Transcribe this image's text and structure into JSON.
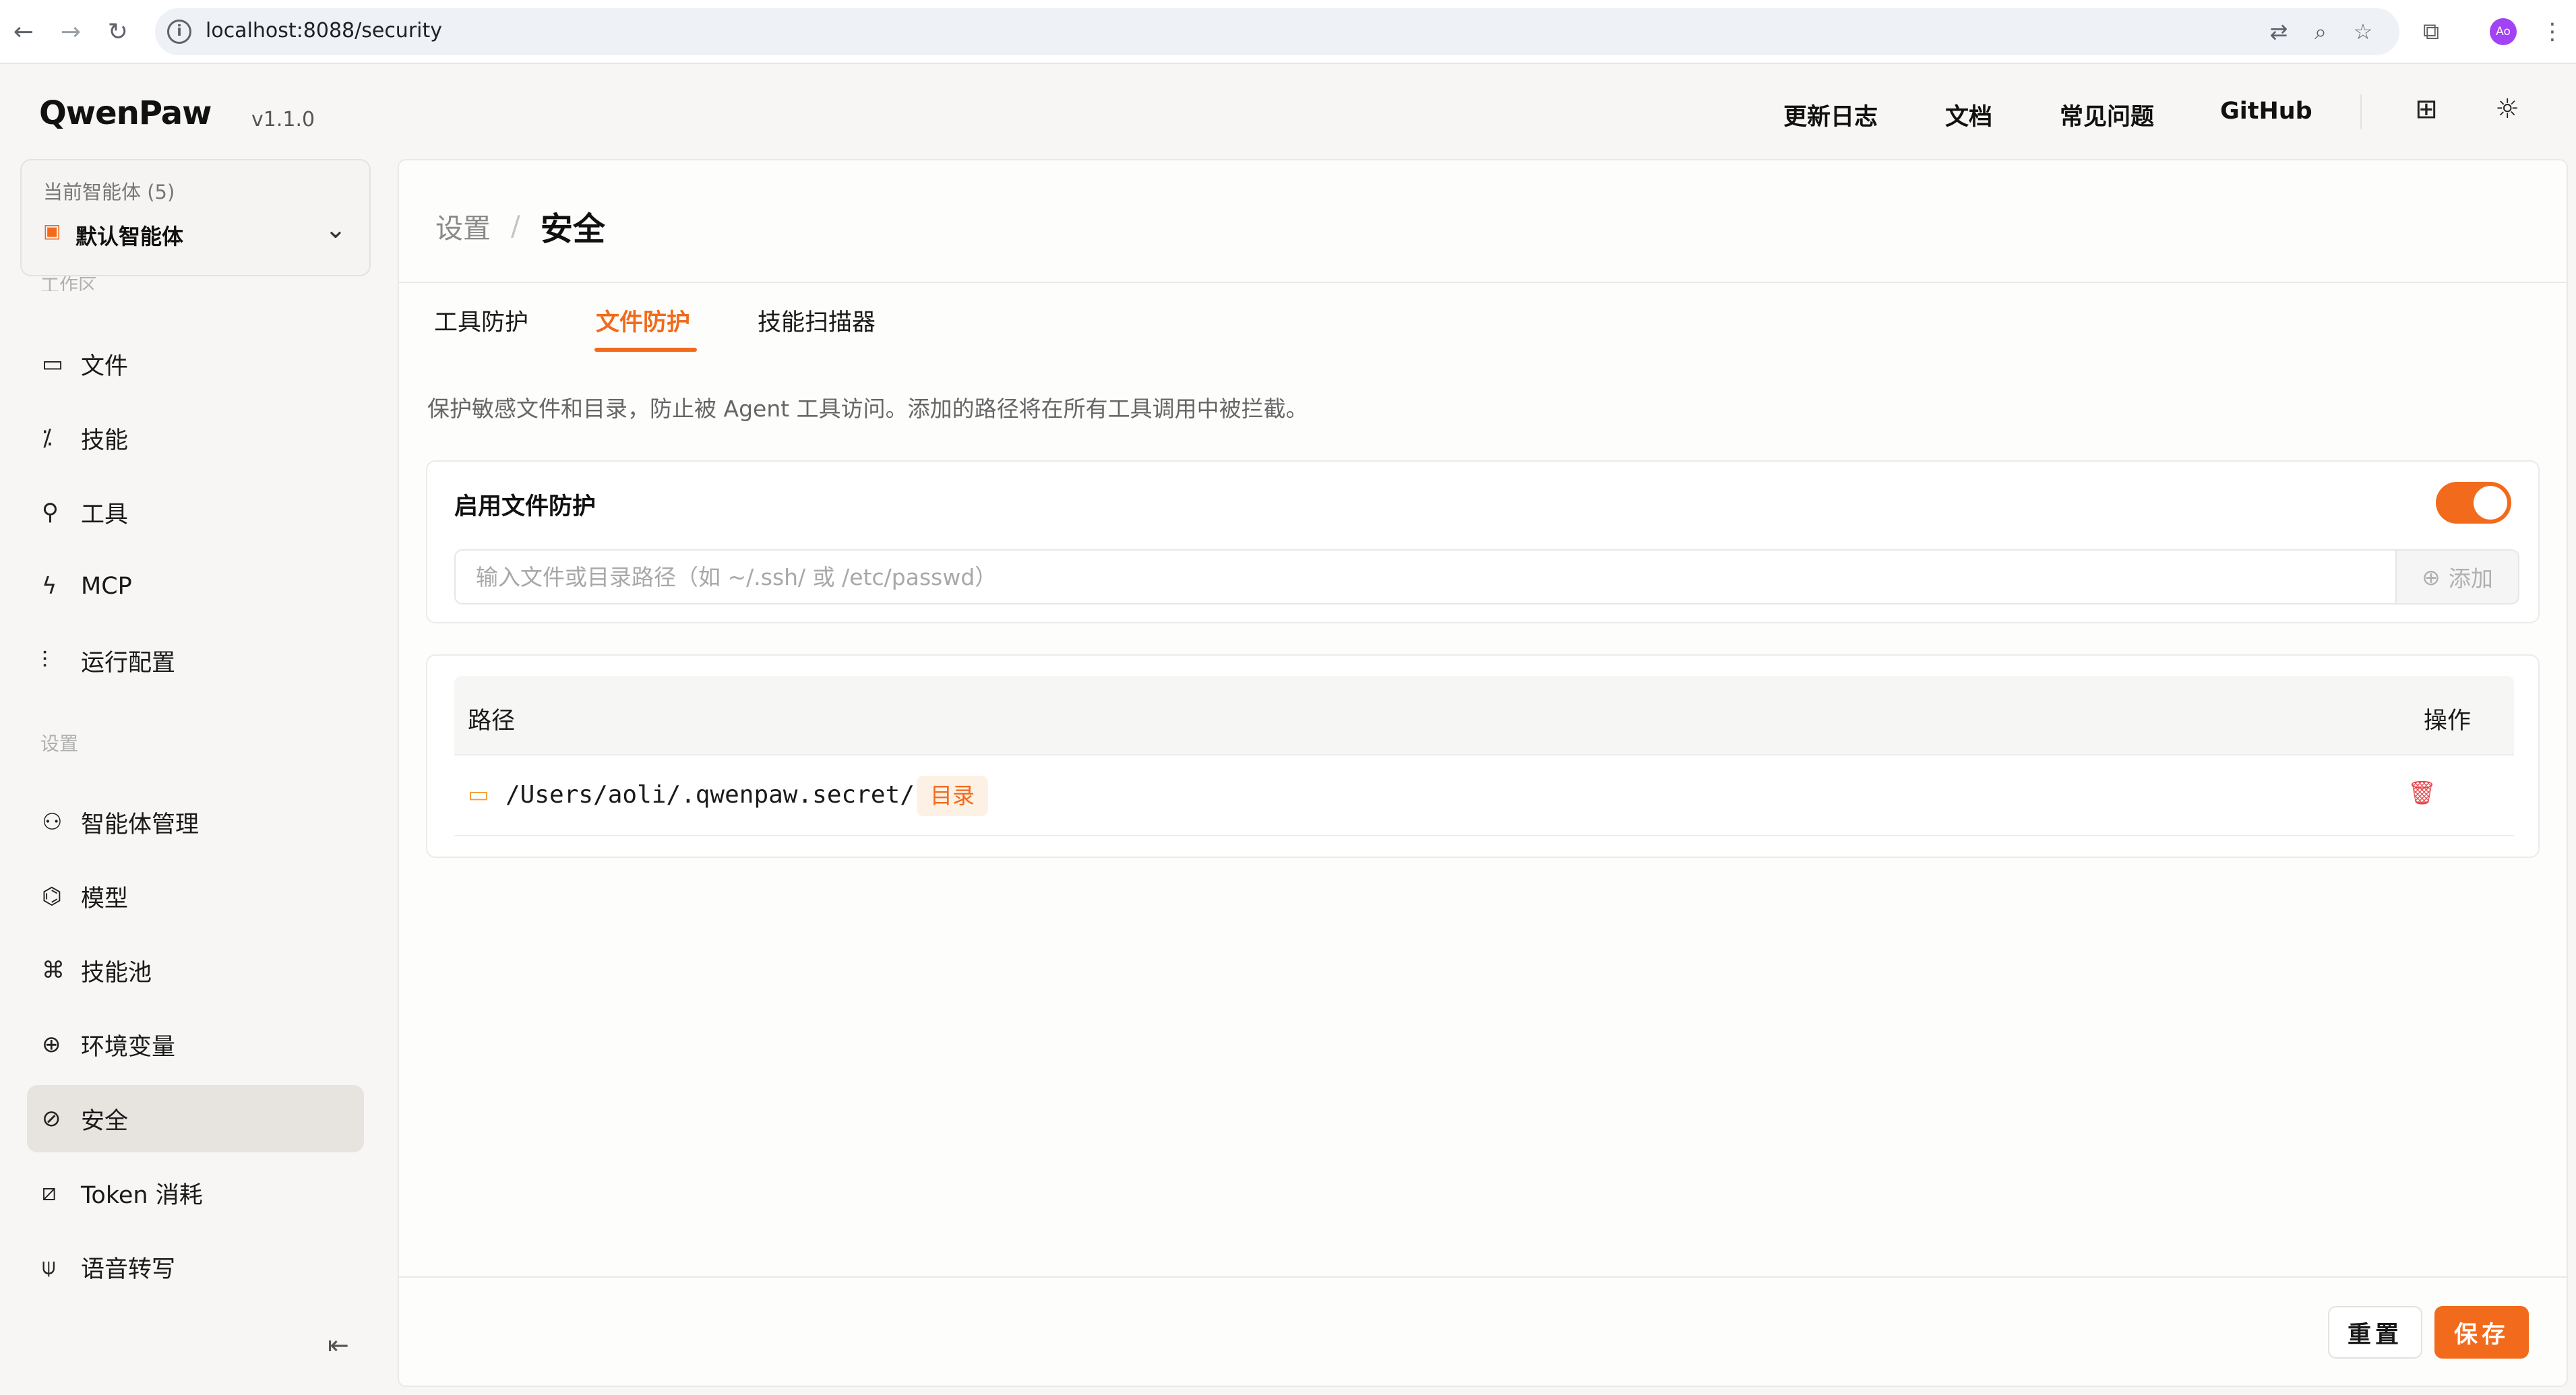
{
  "browser": {
    "url": "localhost:8088/security"
  },
  "header": {
    "logo": "QwenPaw",
    "version": "v1.1.0",
    "nav": [
      "更新日志",
      "文档",
      "常见问题",
      "GitHub"
    ]
  },
  "sidebar": {
    "agent_label": "当前智能体 (5)",
    "agent_name": "默认智能体",
    "workspace_label": "工作区",
    "settings_label": "设置",
    "workspace_items": [
      {
        "label": "文件",
        "icon": "folder-icon"
      },
      {
        "label": "技能",
        "icon": "wand-icon"
      },
      {
        "label": "工具",
        "icon": "wrench-icon"
      },
      {
        "label": "MCP",
        "icon": "bolt-icon"
      },
      {
        "label": "运行配置",
        "icon": "sliders-icon"
      }
    ],
    "settings_items": [
      {
        "label": "智能体管理",
        "icon": "user-gear-icon"
      },
      {
        "label": "模型",
        "icon": "model-icon"
      },
      {
        "label": "技能池",
        "icon": "command-icon"
      },
      {
        "label": "环境变量",
        "icon": "globe-icon"
      },
      {
        "label": "安全",
        "icon": "compass-icon",
        "active": true
      },
      {
        "label": "Token 消耗",
        "icon": "chart-icon"
      },
      {
        "label": "语音转写",
        "icon": "mic-icon"
      }
    ]
  },
  "main": {
    "breadcrumb": {
      "parent": "设置",
      "current": "安全"
    },
    "tabs": [
      {
        "label": "工具防护",
        "active": false
      },
      {
        "label": "文件防护",
        "active": true
      },
      {
        "label": "技能扫描器",
        "active": false
      }
    ],
    "description": "保护敏感文件和目录，防止被 Agent 工具访问。添加的路径将在所有工具调用中被拦截。",
    "protection": {
      "title": "启用文件防护",
      "enabled": true,
      "input_placeholder": "输入文件或目录路径（如 ~/.ssh/ 或 /etc/passwd）",
      "add_label": "添加"
    },
    "table": {
      "columns": [
        "路径",
        "操作"
      ],
      "rows": [
        {
          "path": "/Users/aoli/.qwenpaw.secret/",
          "type": "目录"
        }
      ]
    },
    "footer": {
      "reset_label": "重置",
      "save_label": "保存"
    }
  },
  "colors": {
    "accent": "#f26a1b",
    "danger": "#e5484d",
    "folder": "#f0a030"
  }
}
